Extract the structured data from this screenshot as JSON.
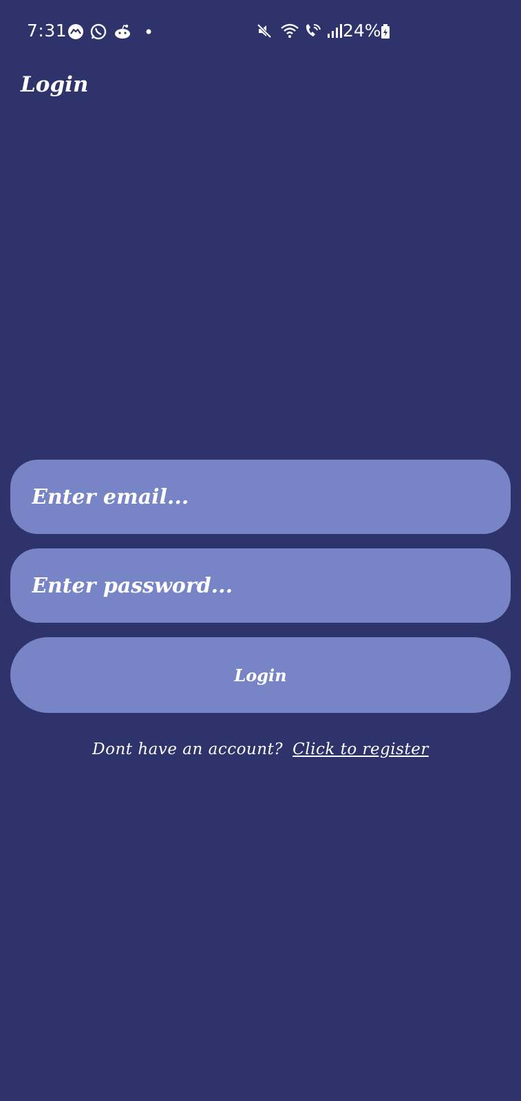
{
  "status_bar": {
    "time": "7:31",
    "battery_percent": "24%",
    "left_icons": [
      "messenger-icon",
      "whatsapp-icon",
      "reddit-icon",
      "notification-dot-icon"
    ],
    "right_icons": [
      "mute-icon",
      "wifi-icon",
      "wifi-calling-icon",
      "signal-icon",
      "battery-charging-icon"
    ]
  },
  "header": {
    "title": "Login"
  },
  "form": {
    "email_placeholder": "Enter email...",
    "email_value": "",
    "password_placeholder": "Enter password...",
    "password_value": "",
    "login_label": "Login"
  },
  "register": {
    "prompt": "Dont have an account?",
    "link_label": "Click to register"
  },
  "colors": {
    "background": "#2e336b",
    "field": "#7785c7",
    "text": "#ffffff"
  }
}
